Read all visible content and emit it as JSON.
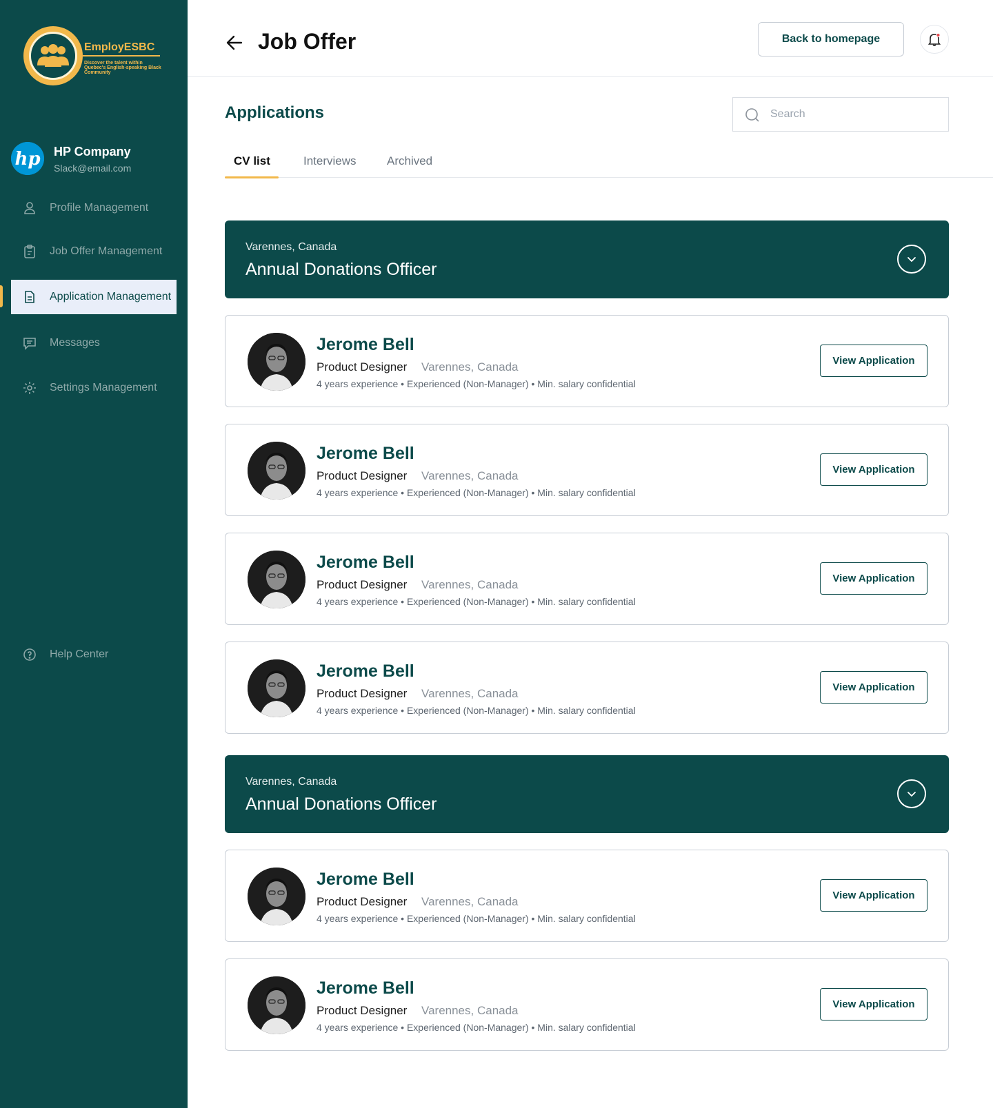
{
  "brand": {
    "name": "EmployESBC",
    "tagline": "Discover the talent within Quebec's English-speaking Black Community",
    "logo_icon": "people-group-icon",
    "colors": {
      "primary": "#0c4a4a",
      "accent": "#f2b84b"
    }
  },
  "company": {
    "name": "HP Company",
    "email": "Slack@email.com",
    "logo_icon": "hp-logo-icon"
  },
  "sidebar": {
    "items": [
      {
        "label": "Profile Management",
        "icon": "user-icon",
        "active": false
      },
      {
        "label": "Job Offer Management",
        "icon": "clipboard-icon",
        "active": false
      },
      {
        "label": "Application Management",
        "icon": "document-icon",
        "active": true
      },
      {
        "label": "Messages",
        "icon": "message-icon",
        "active": false
      },
      {
        "label": "Settings Management",
        "icon": "gear-icon",
        "active": false
      }
    ],
    "help": {
      "label": "Help Center",
      "icon": "help-icon"
    }
  },
  "header": {
    "title": "Job Offer",
    "back_icon": "arrow-left-icon",
    "home_button": "Back to homepage",
    "bell_icon": "bell-icon"
  },
  "main": {
    "section_title": "Applications",
    "search": {
      "placeholder": "Search",
      "value": ""
    },
    "tabs": [
      {
        "label": "CV list",
        "active": true
      },
      {
        "label": "Interviews",
        "active": false
      },
      {
        "label": "Archived",
        "active": false
      }
    ],
    "groups": [
      {
        "location": "Varennes, Canada",
        "title": "Annual Donations Officer",
        "toggle_icon": "chevron-down-icon",
        "candidates": [
          {
            "name": "Jerome Bell",
            "role": "Product Designer",
            "location": "Varennes, Canada",
            "details": "4 years experience • Experienced (Non-Manager) • Min. salary confidential",
            "button": "View Application"
          },
          {
            "name": "Jerome Bell",
            "role": "Product Designer",
            "location": "Varennes, Canada",
            "details": "4 years experience • Experienced (Non-Manager) • Min. salary confidential",
            "button": "View Application"
          },
          {
            "name": "Jerome Bell",
            "role": "Product Designer",
            "location": "Varennes, Canada",
            "details": "4 years experience • Experienced (Non-Manager) • Min. salary confidential",
            "button": "View Application"
          },
          {
            "name": "Jerome Bell",
            "role": "Product Designer",
            "location": "Varennes, Canada",
            "details": "4 years experience • Experienced (Non-Manager) • Min. salary confidential",
            "button": "View Application"
          }
        ]
      },
      {
        "location": "Varennes, Canada",
        "title": "Annual Donations Officer",
        "toggle_icon": "chevron-down-icon",
        "candidates": [
          {
            "name": "Jerome Bell",
            "role": "Product Designer",
            "location": "Varennes, Canada",
            "details": "4 years experience • Experienced (Non-Manager) • Min. salary confidential",
            "button": "View Application"
          },
          {
            "name": "Jerome Bell",
            "role": "Product Designer",
            "location": "Varennes, Canada",
            "details": "4 years experience • Experienced (Non-Manager) • Min. salary confidential",
            "button": "View Application"
          }
        ]
      }
    ]
  }
}
